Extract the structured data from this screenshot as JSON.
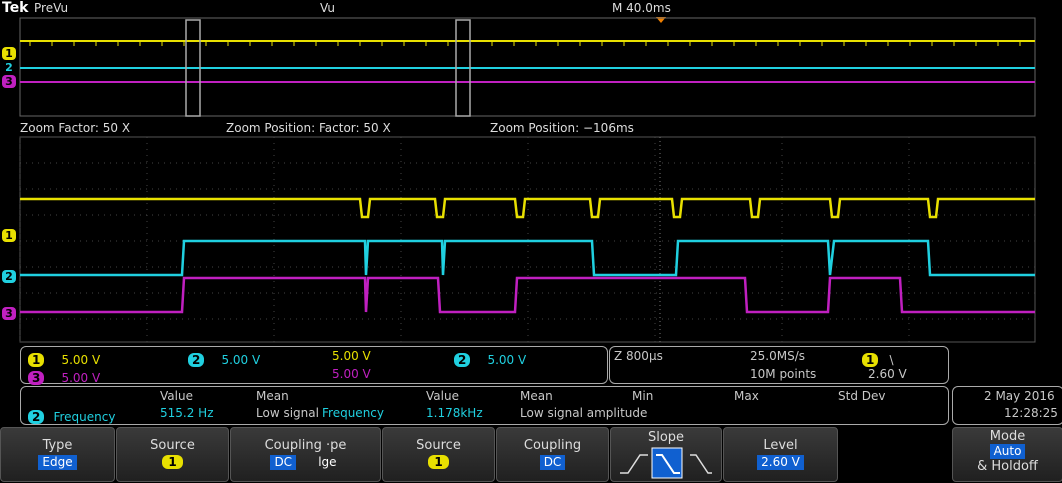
{
  "header": {
    "brand": "Tek",
    "mode": "PreVu",
    "trigger_status": "Vu",
    "timebase": "M 40.0ms"
  },
  "channel_markers": {
    "ch1": "1",
    "ch2": "2",
    "ch3": "3"
  },
  "zoom_info": {
    "factor": "Zoom Factor: 50 X",
    "position_factor": "Zoom Position: Factor: 50 X",
    "position": "Zoom Position: −106ms"
  },
  "channel_settings": {
    "ch1_tag": "1",
    "ch1_scale": "5.00 V",
    "ch2_tag": "2",
    "ch2_scale": "5.00 V",
    "ch3_tag": "3",
    "ch3_scale": "5.00 V",
    "extra_scale_1": "5.00 V",
    "extra_scale_2": "5.00 V",
    "extra_tag": "2",
    "extra_scale_3": "5.00 V"
  },
  "acquisition": {
    "zoom": "Z 800µs",
    "sample_rate": "25.0MS/s",
    "record_length": "10M points",
    "trigger_tag": "1",
    "trigger_slope": "\\",
    "trigger_level": "2.60 V"
  },
  "measurements": {
    "headers": [
      "Value",
      "Mean",
      "Value",
      "Mean",
      "Min",
      "Max",
      "Std Dev"
    ],
    "row_tag": "2",
    "row": [
      "Frequency",
      "515.2 Hz",
      "Low signal",
      "Frequency",
      "1.178kHz",
      "Low signal amplitude"
    ]
  },
  "datetime": {
    "date": "2 May  2016",
    "time": "12:28:25"
  },
  "buttons": {
    "type": {
      "label": "Type",
      "value": "Edge"
    },
    "source1": {
      "label": "Source",
      "value": "1"
    },
    "coupling_type": {
      "label": "Coupling  ·pe",
      "value1": "DC",
      "value2": "lge"
    },
    "source2": {
      "label": "Source",
      "value": "1"
    },
    "coupling": {
      "label": "Coupling",
      "value": "DC"
    },
    "slope": {
      "label": "Slope"
    },
    "level": {
      "label": "Level",
      "value": "2.60 V"
    },
    "mode": {
      "label": "Mode",
      "value": "Auto",
      "extra": "& Holdoff"
    }
  },
  "colors": {
    "ch1": "#e8e000",
    "ch2": "#20d0e0",
    "ch3": "#c020c0",
    "accent": "#1060d0"
  }
}
